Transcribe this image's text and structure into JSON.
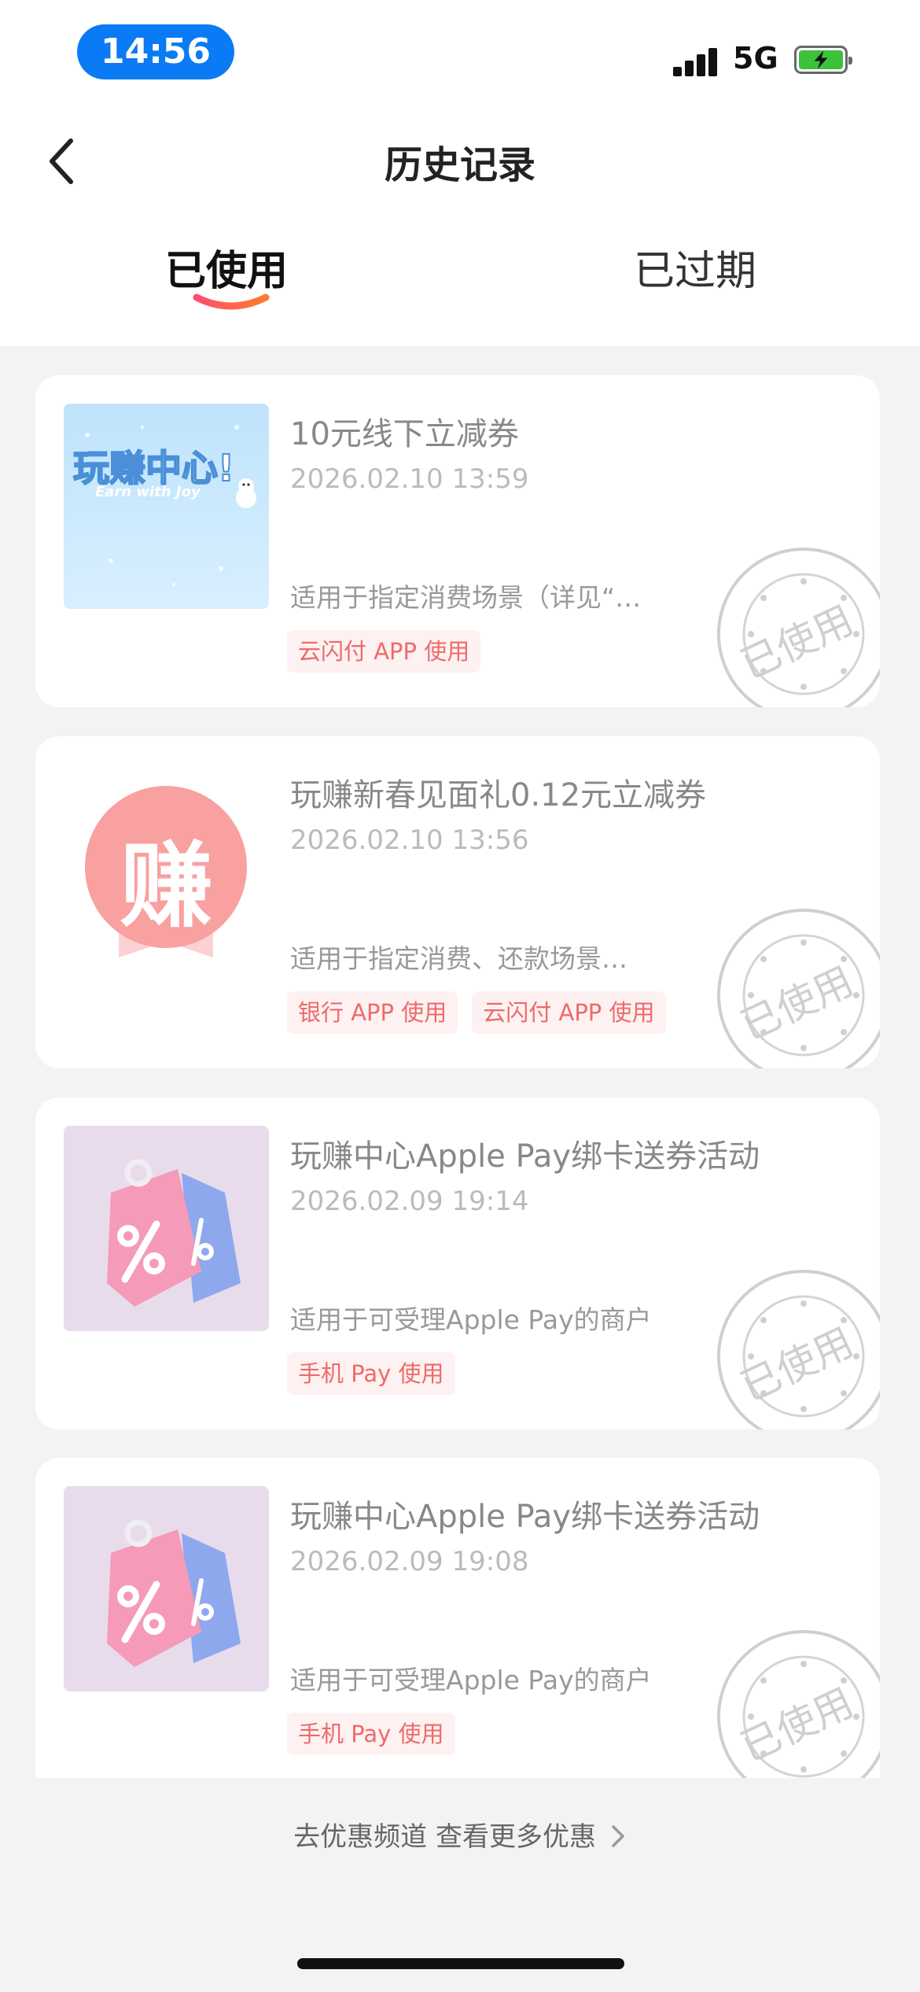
{
  "status_bar": {
    "time": "14:56",
    "network": "5G"
  },
  "header": {
    "title": "历史记录",
    "back_icon": "chevron-left-icon"
  },
  "tabs": [
    {
      "label": "已使用",
      "active": true
    },
    {
      "label": "已过期",
      "active": false
    }
  ],
  "colors": {
    "accent": "#f0544f",
    "status_pill": "#0a7bf5",
    "tag_text": "#ee6a6a",
    "tag_bg": "#fdf1f1"
  },
  "coupons": [
    {
      "title": "10元线下立减券",
      "time": "2026.02.10 13:59",
      "desc": "适用于指定消费场景（详见“…",
      "tags": [
        "云闪付 APP 使用"
      ],
      "stamp": "已使用",
      "thumb_title": "玩赚中心!",
      "thumb_subtitle": "Earn with Joy"
    },
    {
      "title": "玩赚新春见面礼0.12元立减券",
      "time": "2026.02.10 13:56",
      "desc": "适用于指定消费、还款场景…",
      "tags": [
        "银行 APP 使用",
        "云闪付 APP 使用"
      ],
      "stamp": "已使用",
      "thumb_title": "赚"
    },
    {
      "title": "玩赚中心Apple Pay绑卡送券活动",
      "time": "2026.02.09 19:14",
      "desc": "适用于可受理Apple Pay的商户",
      "tags": [
        "手机 Pay 使用"
      ],
      "stamp": "已使用"
    },
    {
      "title": "玩赚中心Apple Pay绑卡送券活动",
      "time": "2026.02.09 19:08",
      "desc": "适用于可受理Apple Pay的商户",
      "tags": [
        "手机 Pay 使用"
      ],
      "stamp": "已使用"
    }
  ],
  "footer": {
    "more_link": "去优惠频道 查看更多优惠"
  }
}
